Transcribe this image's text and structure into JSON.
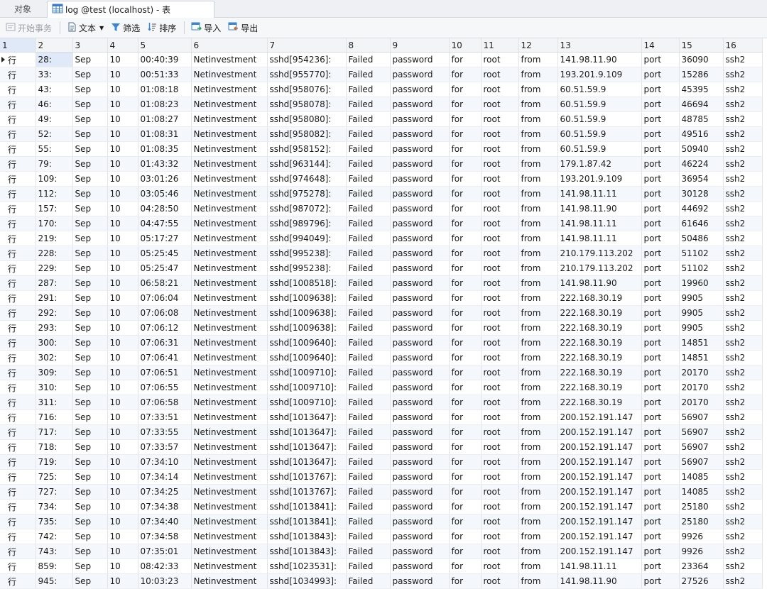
{
  "tabs": {
    "objects_label": "对象",
    "active_label": "log @test (localhost) - 表"
  },
  "toolbar": {
    "begin_tx": "开始事务",
    "text": "文本",
    "filter": "筛选",
    "sort": "排序",
    "import": "导入",
    "export": "导出"
  },
  "table": {
    "headers": [
      "1",
      "2",
      "3",
      "4",
      "5",
      "6",
      "7",
      "8",
      "9",
      "10",
      "11",
      "12",
      "13",
      "14",
      "15",
      "16"
    ],
    "rows": [
      [
        "行",
        "28:",
        "Sep",
        "10",
        "00:40:39",
        "Netinvestment",
        "sshd[954236]:",
        "Failed",
        "password",
        "for",
        "root",
        "from",
        "141.98.11.90",
        "port",
        "36090",
        "ssh2"
      ],
      [
        "行",
        "33:",
        "Sep",
        "10",
        "00:51:33",
        "Netinvestment",
        "sshd[955770]:",
        "Failed",
        "password",
        "for",
        "root",
        "from",
        "193.201.9.109",
        "port",
        "15286",
        "ssh2"
      ],
      [
        "行",
        "43:",
        "Sep",
        "10",
        "01:08:18",
        "Netinvestment",
        "sshd[958076]:",
        "Failed",
        "password",
        "for",
        "root",
        "from",
        "60.51.59.9",
        "port",
        "45395",
        "ssh2"
      ],
      [
        "行",
        "46:",
        "Sep",
        "10",
        "01:08:23",
        "Netinvestment",
        "sshd[958078]:",
        "Failed",
        "password",
        "for",
        "root",
        "from",
        "60.51.59.9",
        "port",
        "46694",
        "ssh2"
      ],
      [
        "行",
        "49:",
        "Sep",
        "10",
        "01:08:27",
        "Netinvestment",
        "sshd[958080]:",
        "Failed",
        "password",
        "for",
        "root",
        "from",
        "60.51.59.9",
        "port",
        "48785",
        "ssh2"
      ],
      [
        "行",
        "52:",
        "Sep",
        "10",
        "01:08:31",
        "Netinvestment",
        "sshd[958082]:",
        "Failed",
        "password",
        "for",
        "root",
        "from",
        "60.51.59.9",
        "port",
        "49516",
        "ssh2"
      ],
      [
        "行",
        "55:",
        "Sep",
        "10",
        "01:08:35",
        "Netinvestment",
        "sshd[958152]:",
        "Failed",
        "password",
        "for",
        "root",
        "from",
        "60.51.59.9",
        "port",
        "50940",
        "ssh2"
      ],
      [
        "行",
        "79:",
        "Sep",
        "10",
        "01:43:32",
        "Netinvestment",
        "sshd[963144]:",
        "Failed",
        "password",
        "for",
        "root",
        "from",
        "179.1.87.42",
        "port",
        "46224",
        "ssh2"
      ],
      [
        "行",
        "109:",
        "Sep",
        "10",
        "03:01:26",
        "Netinvestment",
        "sshd[974648]:",
        "Failed",
        "password",
        "for",
        "root",
        "from",
        "193.201.9.109",
        "port",
        "36954",
        "ssh2"
      ],
      [
        "行",
        "112:",
        "Sep",
        "10",
        "03:05:46",
        "Netinvestment",
        "sshd[975278]:",
        "Failed",
        "password",
        "for",
        "root",
        "from",
        "141.98.11.11",
        "port",
        "30128",
        "ssh2"
      ],
      [
        "行",
        "157:",
        "Sep",
        "10",
        "04:28:50",
        "Netinvestment",
        "sshd[987072]:",
        "Failed",
        "password",
        "for",
        "root",
        "from",
        "141.98.11.90",
        "port",
        "44692",
        "ssh2"
      ],
      [
        "行",
        "170:",
        "Sep",
        "10",
        "04:47:55",
        "Netinvestment",
        "sshd[989796]:",
        "Failed",
        "password",
        "for",
        "root",
        "from",
        "141.98.11.11",
        "port",
        "61646",
        "ssh2"
      ],
      [
        "行",
        "219:",
        "Sep",
        "10",
        "05:17:27",
        "Netinvestment",
        "sshd[994049]:",
        "Failed",
        "password",
        "for",
        "root",
        "from",
        "141.98.11.11",
        "port",
        "50486",
        "ssh2"
      ],
      [
        "行",
        "228:",
        "Sep",
        "10",
        "05:25:45",
        "Netinvestment",
        "sshd[995238]:",
        "Failed",
        "password",
        "for",
        "root",
        "from",
        "210.179.113.202",
        "port",
        "51102",
        "ssh2"
      ],
      [
        "行",
        "229:",
        "Sep",
        "10",
        "05:25:47",
        "Netinvestment",
        "sshd[995238]:",
        "Failed",
        "password",
        "for",
        "root",
        "from",
        "210.179.113.202",
        "port",
        "51102",
        "ssh2"
      ],
      [
        "行",
        "287:",
        "Sep",
        "10",
        "06:58:21",
        "Netinvestment",
        "sshd[1008518]:",
        "Failed",
        "password",
        "for",
        "root",
        "from",
        "141.98.11.90",
        "port",
        "19960",
        "ssh2"
      ],
      [
        "行",
        "291:",
        "Sep",
        "10",
        "07:06:04",
        "Netinvestment",
        "sshd[1009638]:",
        "Failed",
        "password",
        "for",
        "root",
        "from",
        "222.168.30.19",
        "port",
        "9905",
        "ssh2"
      ],
      [
        "行",
        "292:",
        "Sep",
        "10",
        "07:06:08",
        "Netinvestment",
        "sshd[1009638]:",
        "Failed",
        "password",
        "for",
        "root",
        "from",
        "222.168.30.19",
        "port",
        "9905",
        "ssh2"
      ],
      [
        "行",
        "293:",
        "Sep",
        "10",
        "07:06:12",
        "Netinvestment",
        "sshd[1009638]:",
        "Failed",
        "password",
        "for",
        "root",
        "from",
        "222.168.30.19",
        "port",
        "9905",
        "ssh2"
      ],
      [
        "行",
        "300:",
        "Sep",
        "10",
        "07:06:31",
        "Netinvestment",
        "sshd[1009640]:",
        "Failed",
        "password",
        "for",
        "root",
        "from",
        "222.168.30.19",
        "port",
        "14851",
        "ssh2"
      ],
      [
        "行",
        "302:",
        "Sep",
        "10",
        "07:06:41",
        "Netinvestment",
        "sshd[1009640]:",
        "Failed",
        "password",
        "for",
        "root",
        "from",
        "222.168.30.19",
        "port",
        "14851",
        "ssh2"
      ],
      [
        "行",
        "309:",
        "Sep",
        "10",
        "07:06:51",
        "Netinvestment",
        "sshd[1009710]:",
        "Failed",
        "password",
        "for",
        "root",
        "from",
        "222.168.30.19",
        "port",
        "20170",
        "ssh2"
      ],
      [
        "行",
        "310:",
        "Sep",
        "10",
        "07:06:55",
        "Netinvestment",
        "sshd[1009710]:",
        "Failed",
        "password",
        "for",
        "root",
        "from",
        "222.168.30.19",
        "port",
        "20170",
        "ssh2"
      ],
      [
        "行",
        "311:",
        "Sep",
        "10",
        "07:06:58",
        "Netinvestment",
        "sshd[1009710]:",
        "Failed",
        "password",
        "for",
        "root",
        "from",
        "222.168.30.19",
        "port",
        "20170",
        "ssh2"
      ],
      [
        "行",
        "716:",
        "Sep",
        "10",
        "07:33:51",
        "Netinvestment",
        "sshd[1013647]:",
        "Failed",
        "password",
        "for",
        "root",
        "from",
        "200.152.191.147",
        "port",
        "56907",
        "ssh2"
      ],
      [
        "行",
        "717:",
        "Sep",
        "10",
        "07:33:55",
        "Netinvestment",
        "sshd[1013647]:",
        "Failed",
        "password",
        "for",
        "root",
        "from",
        "200.152.191.147",
        "port",
        "56907",
        "ssh2"
      ],
      [
        "行",
        "718:",
        "Sep",
        "10",
        "07:33:57",
        "Netinvestment",
        "sshd[1013647]:",
        "Failed",
        "password",
        "for",
        "root",
        "from",
        "200.152.191.147",
        "port",
        "56907",
        "ssh2"
      ],
      [
        "行",
        "719:",
        "Sep",
        "10",
        "07:34:10",
        "Netinvestment",
        "sshd[1013647]:",
        "Failed",
        "password",
        "for",
        "root",
        "from",
        "200.152.191.147",
        "port",
        "56907",
        "ssh2"
      ],
      [
        "行",
        "725:",
        "Sep",
        "10",
        "07:34:14",
        "Netinvestment",
        "sshd[1013767]:",
        "Failed",
        "password",
        "for",
        "root",
        "from",
        "200.152.191.147",
        "port",
        "14085",
        "ssh2"
      ],
      [
        "行",
        "727:",
        "Sep",
        "10",
        "07:34:25",
        "Netinvestment",
        "sshd[1013767]:",
        "Failed",
        "password",
        "for",
        "root",
        "from",
        "200.152.191.147",
        "port",
        "14085",
        "ssh2"
      ],
      [
        "行",
        "734:",
        "Sep",
        "10",
        "07:34:38",
        "Netinvestment",
        "sshd[1013841]:",
        "Failed",
        "password",
        "for",
        "root",
        "from",
        "200.152.191.147",
        "port",
        "25180",
        "ssh2"
      ],
      [
        "行",
        "735:",
        "Sep",
        "10",
        "07:34:40",
        "Netinvestment",
        "sshd[1013841]:",
        "Failed",
        "password",
        "for",
        "root",
        "from",
        "200.152.191.147",
        "port",
        "25180",
        "ssh2"
      ],
      [
        "行",
        "742:",
        "Sep",
        "10",
        "07:34:58",
        "Netinvestment",
        "sshd[1013843]:",
        "Failed",
        "password",
        "for",
        "root",
        "from",
        "200.152.191.147",
        "port",
        "9926",
        "ssh2"
      ],
      [
        "行",
        "743:",
        "Sep",
        "10",
        "07:35:01",
        "Netinvestment",
        "sshd[1013843]:",
        "Failed",
        "password",
        "for",
        "root",
        "from",
        "200.152.191.147",
        "port",
        "9926",
        "ssh2"
      ],
      [
        "行",
        "859:",
        "Sep",
        "10",
        "08:42:33",
        "Netinvestment",
        "sshd[1023531]:",
        "Failed",
        "password",
        "for",
        "root",
        "from",
        "141.98.11.11",
        "port",
        "23364",
        "ssh2"
      ],
      [
        "行",
        "945:",
        "Sep",
        "10",
        "10:03:23",
        "Netinvestment",
        "sshd[1034993]:",
        "Failed",
        "password",
        "for",
        "root",
        "from",
        "141.98.11.90",
        "port",
        "27526",
        "ssh2"
      ]
    ]
  }
}
